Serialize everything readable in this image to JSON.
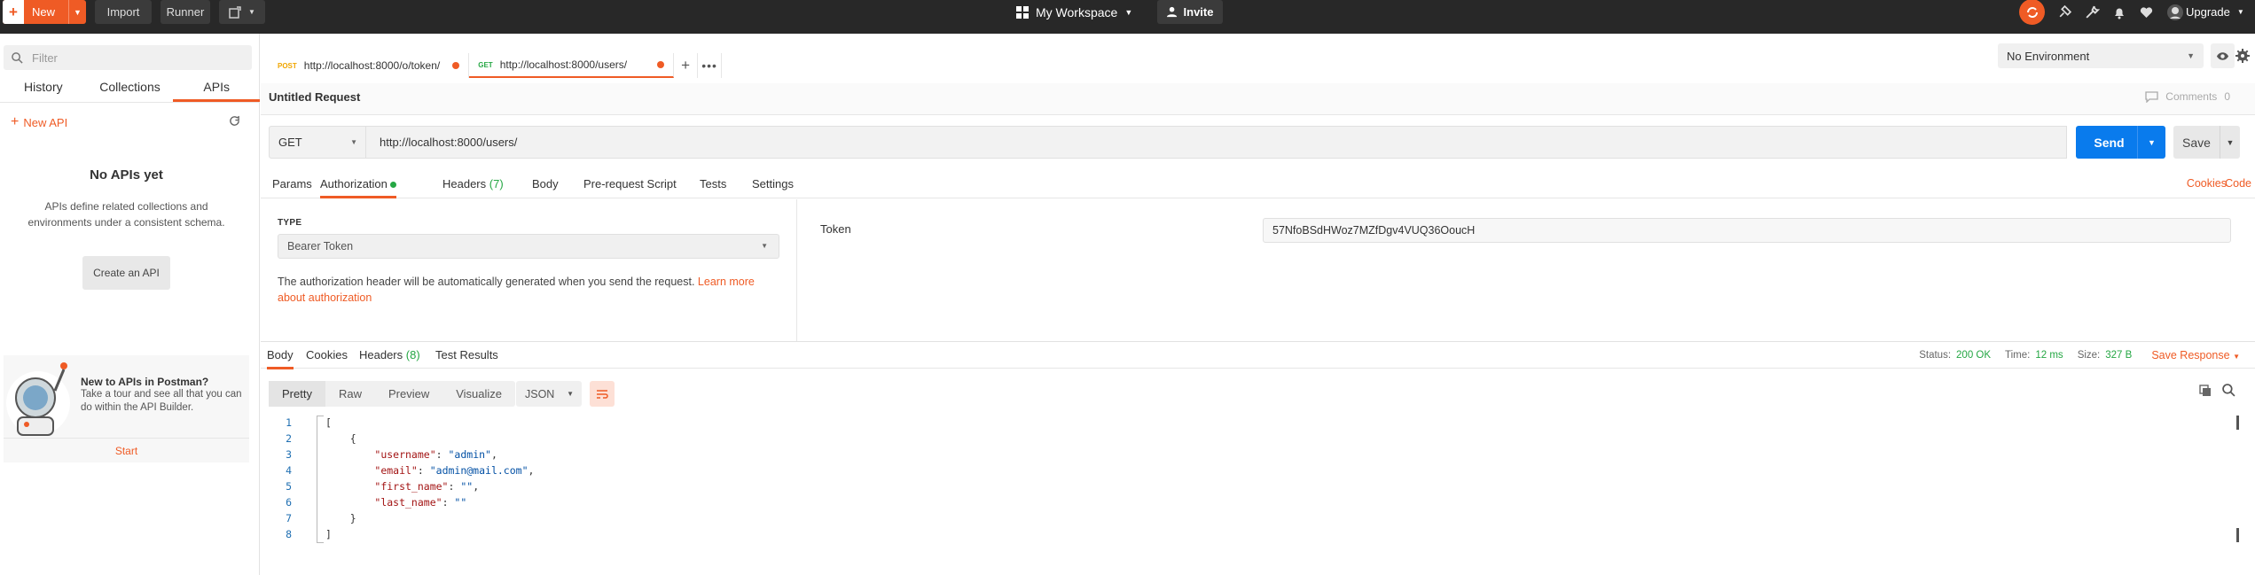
{
  "topbar": {
    "new_label": "New",
    "import_label": "Import",
    "runner_label": "Runner",
    "workspace_label": "My Workspace",
    "invite_label": "Invite",
    "upgrade_label": "Upgrade",
    "accent_color": "#ef5b25"
  },
  "sidebar": {
    "filter_placeholder": "Filter",
    "tabs": [
      {
        "label": "History",
        "active": false
      },
      {
        "label": "Collections",
        "active": false
      },
      {
        "label": "APIs",
        "active": true
      }
    ],
    "new_api_label": "New API",
    "empty_title": "No APIs yet",
    "empty_desc": "APIs define related collections and environments under a consistent schema.",
    "create_api_label": "Create an API",
    "promo": {
      "title": "New to APIs in Postman?",
      "desc": "Take a tour and see all that you can do within the API Builder.",
      "start_label": "Start"
    }
  },
  "request_tabs": [
    {
      "method": "POST",
      "method_color": "#f0a500",
      "url": "http://localhost:8000/o/token/",
      "unsaved": true,
      "active": false
    },
    {
      "method": "GET",
      "method_color": "#25a744",
      "url": "http://localhost:8000/users/",
      "unsaved": true,
      "active": true
    }
  ],
  "environment": {
    "selected": "No Environment"
  },
  "request": {
    "title": "Untitled Request",
    "comments_label": "Comments",
    "comments_count": "0",
    "method": "GET",
    "url": "http://localhost:8000/users/",
    "send_label": "Send",
    "save_label": "Save",
    "subtabs": {
      "params": "Params",
      "authorization": "Authorization",
      "headers": "Headers",
      "headers_count": "(7)",
      "body": "Body",
      "prerequest": "Pre-request Script",
      "tests": "Tests",
      "settings": "Settings"
    },
    "cookies_label": "Cookies",
    "code_label": "Code"
  },
  "auth": {
    "type_label": "TYPE",
    "type_value": "Bearer Token",
    "info_text": "The authorization header will be automatically generated when you send the request. ",
    "learn_more": "Learn more about authorization",
    "token_label": "Token",
    "token_value": "57NfoBSdHWoz7MZfDgv4VUQ36OoucH"
  },
  "response": {
    "tabs": {
      "body": "Body",
      "cookies": "Cookies",
      "headers": "Headers",
      "headers_count": "(8)",
      "test_results": "Test Results"
    },
    "status_label": "Status:",
    "status_value": "200 OK",
    "time_label": "Time:",
    "time_value": "12 ms",
    "size_label": "Size:",
    "size_value": "327 B",
    "save_response_label": "Save Response",
    "view_tabs": [
      "Pretty",
      "Raw",
      "Preview",
      "Visualize"
    ],
    "format": "JSON",
    "body_lines": [
      {
        "n": "1",
        "indent": "",
        "parts": [
          {
            "t": "[",
            "c": "p"
          }
        ]
      },
      {
        "n": "2",
        "indent": "    ",
        "parts": [
          {
            "t": "{",
            "c": "p"
          }
        ]
      },
      {
        "n": "3",
        "indent": "        ",
        "parts": [
          {
            "t": "\"username\"",
            "c": "key"
          },
          {
            "t": ": ",
            "c": "p"
          },
          {
            "t": "\"admin\"",
            "c": "str"
          },
          {
            "t": ",",
            "c": "p"
          }
        ]
      },
      {
        "n": "4",
        "indent": "        ",
        "parts": [
          {
            "t": "\"email\"",
            "c": "key"
          },
          {
            "t": ": ",
            "c": "p"
          },
          {
            "t": "\"admin@mail.com\"",
            "c": "str"
          },
          {
            "t": ",",
            "c": "p"
          }
        ]
      },
      {
        "n": "5",
        "indent": "        ",
        "parts": [
          {
            "t": "\"first_name\"",
            "c": "key"
          },
          {
            "t": ": ",
            "c": "p"
          },
          {
            "t": "\"\"",
            "c": "str"
          },
          {
            "t": ",",
            "c": "p"
          }
        ]
      },
      {
        "n": "6",
        "indent": "        ",
        "parts": [
          {
            "t": "\"last_name\"",
            "c": "key"
          },
          {
            "t": ": ",
            "c": "p"
          },
          {
            "t": "\"\"",
            "c": "str"
          }
        ]
      },
      {
        "n": "7",
        "indent": "    ",
        "parts": [
          {
            "t": "}",
            "c": "p"
          }
        ]
      },
      {
        "n": "8",
        "indent": "",
        "parts": [
          {
            "t": "]",
            "c": "p"
          }
        ]
      }
    ]
  }
}
